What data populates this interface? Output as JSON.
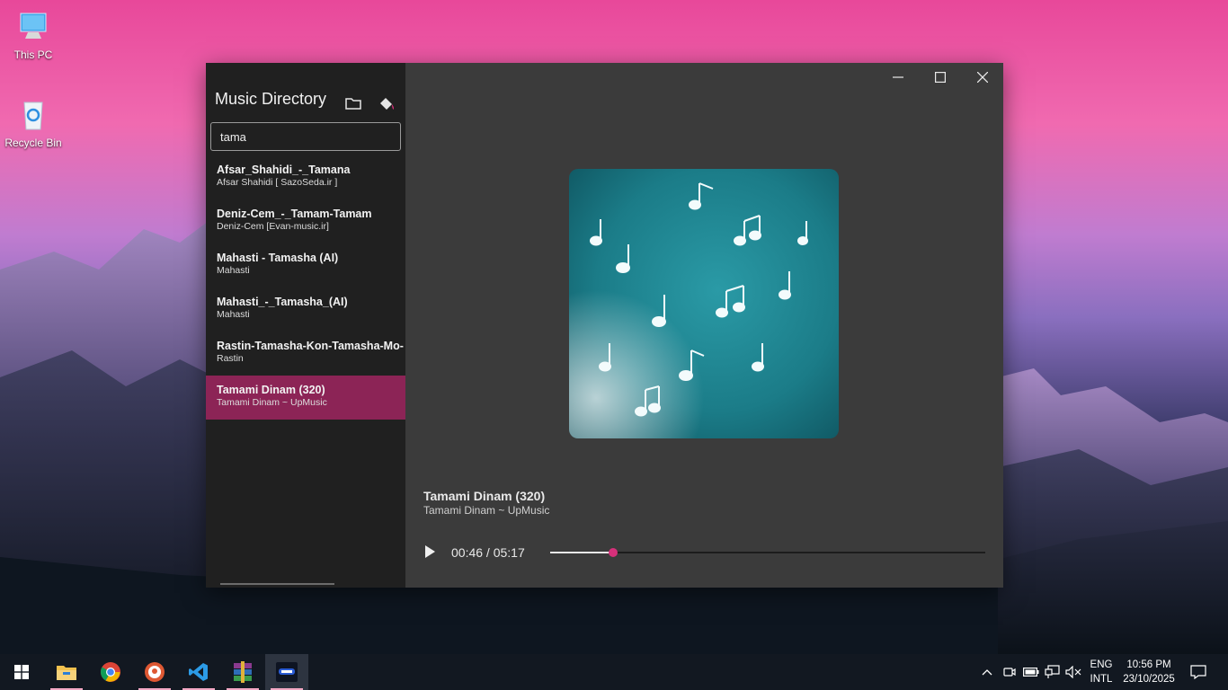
{
  "desktop": {
    "icons": [
      {
        "label": "This PC"
      },
      {
        "label": "Recycle Bin"
      }
    ]
  },
  "sidebar": {
    "title": "Music Directory",
    "search_value": "tama",
    "items": [
      {
        "title": "Afsar_Shahidi_-_Tamana",
        "subtitle": "Afsar Shahidi [ SazoSeda.ir ]"
      },
      {
        "title": "Deniz-Cem_-_Tamam-Tamam",
        "subtitle": "Deniz-Cem [Evan-music.ir]"
      },
      {
        "title": "Mahasti - Tamasha (AI)",
        "subtitle": "Mahasti"
      },
      {
        "title": "Mahasti_-_Tamasha_(AI)",
        "subtitle": "Mahasti"
      },
      {
        "title": "Rastin-Tamasha-Kon-Tamasha-Mo-",
        "subtitle": "Rastin"
      },
      {
        "title": "Tamami Dinam (320)",
        "subtitle": "Tamami Dinam ~ UpMusic"
      }
    ],
    "selected_index": 5
  },
  "player": {
    "title": "Tamami Dinam (320)",
    "artist": "Tamami Dinam ~ UpMusic",
    "time": "00:46 / 05:17",
    "progress": 0.145
  },
  "taskbar": {
    "lang_top": "ENG",
    "lang_bottom": "INTL",
    "time": "10:56 PM",
    "date": "23/10/2025"
  },
  "colors": {
    "accent": "#8c2456",
    "seek_thumb": "#d6307a"
  }
}
